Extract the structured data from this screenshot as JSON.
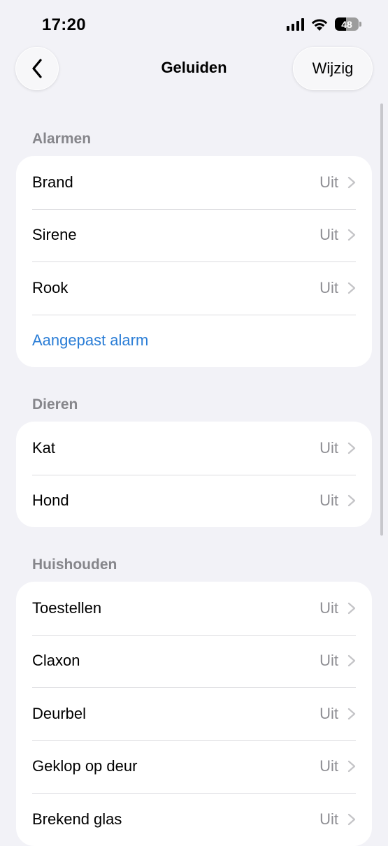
{
  "status_bar": {
    "time": "17:20",
    "battery": "48",
    "battery_level": 0.48
  },
  "nav": {
    "title": "Geluiden",
    "edit_label": "Wijzig"
  },
  "sections": {
    "alarms": {
      "header": "Alarmen",
      "items": [
        {
          "label": "Brand",
          "value": "Uit"
        },
        {
          "label": "Sirene",
          "value": "Uit"
        },
        {
          "label": "Rook",
          "value": "Uit"
        }
      ],
      "custom_link": "Aangepast alarm"
    },
    "animals": {
      "header": "Dieren",
      "items": [
        {
          "label": "Kat",
          "value": "Uit"
        },
        {
          "label": "Hond",
          "value": "Uit"
        }
      ]
    },
    "household": {
      "header": "Huishouden",
      "items": [
        {
          "label": "Toestellen",
          "value": "Uit"
        },
        {
          "label": "Claxon",
          "value": "Uit"
        },
        {
          "label": "Deurbel",
          "value": "Uit"
        },
        {
          "label": "Geklop op deur",
          "value": "Uit"
        },
        {
          "label": "Brekend glas",
          "value": "Uit"
        }
      ]
    }
  },
  "colors": {
    "background": "#f2f2f7",
    "link": "#2a7dd6",
    "secondary_text": "#8e8e93"
  },
  "icons": [
    "chevron-left-icon",
    "chevron-right-icon",
    "cellular-signal-icon",
    "wifi-icon",
    "battery-icon"
  ]
}
